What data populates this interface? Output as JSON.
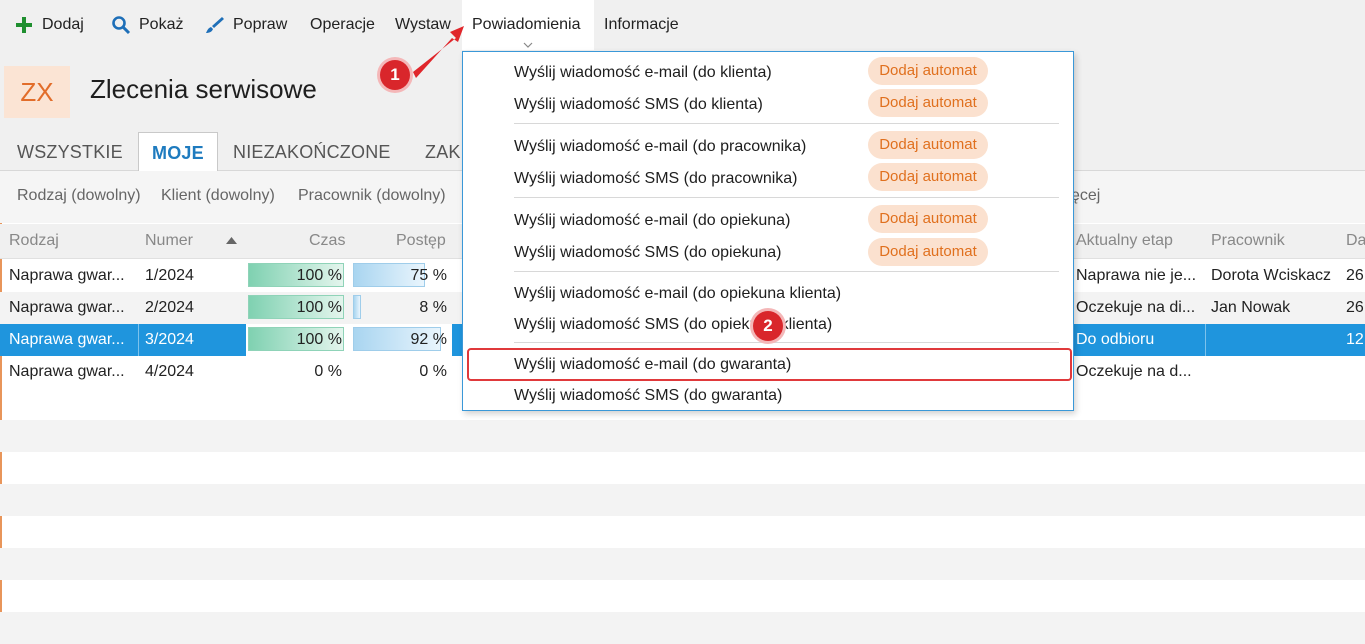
{
  "toolbar": {
    "add": "Dodaj",
    "show": "Pokaż",
    "edit": "Popraw",
    "operations": "Operacje",
    "issue": "Wystaw",
    "notifications": "Powiadomienia",
    "info": "Informacje"
  },
  "header": {
    "logo": "ZX",
    "title": "Zlecenia serwisowe"
  },
  "tabs": [
    "WSZYSTKIE",
    "MOJE",
    "NIEZAKOŃCZONE",
    "ZAK"
  ],
  "filters": [
    "Rodzaj (dowolny)",
    "Klient (dowolny)",
    "Pracownik (dowolny)",
    "ęcej"
  ],
  "columns": [
    "Rodzaj",
    "Numer",
    "Czas",
    "Postęp",
    "Aktualny etap",
    "Pracownik",
    "Da"
  ],
  "rows": [
    {
      "type": "Naprawa gwar...",
      "number": "1/2024",
      "time": "100 %",
      "progress": "75 %",
      "progress_value": 75,
      "time_value": 100,
      "stage": "Naprawa nie je...",
      "employee": "Dorota Wciskacz",
      "date": "26"
    },
    {
      "type": "Naprawa gwar...",
      "number": "2/2024",
      "time": "100 %",
      "progress": "8 %",
      "progress_value": 8,
      "time_value": 100,
      "stage": "Oczekuje na di...",
      "employee": "Jan Nowak",
      "date": "26"
    },
    {
      "type": "Naprawa gwar...",
      "number": "3/2024",
      "time": "100 %",
      "progress": "92 %",
      "progress_value": 92,
      "time_value": 100,
      "stage": "Do odbioru",
      "employee": "",
      "date": "12"
    },
    {
      "type": "Naprawa gwar...",
      "number": "4/2024",
      "time": "0 %",
      "progress": "0 %",
      "progress_value": 0,
      "time_value": 0,
      "stage": "Oczekuje na d...",
      "employee": "",
      "date": ""
    }
  ],
  "menu": {
    "badge_label": "Dodaj automat",
    "items": [
      "Wyślij wiadomość e-mail (do klienta)",
      "Wyślij wiadomość SMS (do klienta)",
      "Wyślij wiadomość e-mail (do pracownika)",
      "Wyślij wiadomość SMS (do pracownika)",
      "Wyślij wiadomość e-mail (do opiekuna)",
      "Wyślij wiadomość SMS (do opiekuna)",
      "Wyślij wiadomość e-mail (do opiekuna klienta)",
      "Wyślij wiadomość SMS (do opiekuna klienta)",
      "Wyślij wiadomość e-mail (do gwaranta)",
      "Wyślij wiadomość SMS (do gwaranta)"
    ]
  },
  "callouts": [
    "1",
    "2"
  ],
  "colors": {
    "accent": "#1f95dd",
    "logo": "#e26d2a",
    "badge_bg": "#fbe1cf",
    "highlight": "#e0393b"
  }
}
